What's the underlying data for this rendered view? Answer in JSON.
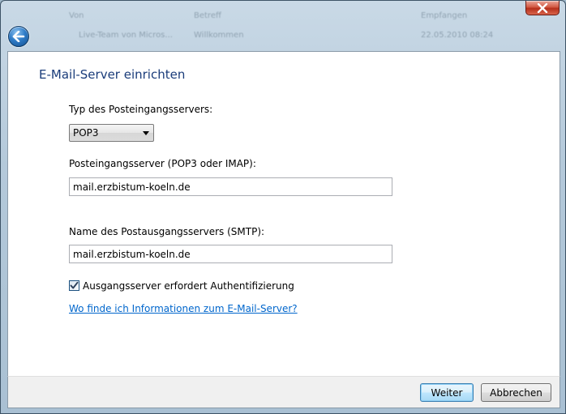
{
  "background_window": {
    "ghost_texts": [
      "Von",
      "Betreff",
      "Empfangen",
      "Live-Team von Micros...",
      "Willkommen",
      "22.05.2010 08:24"
    ]
  },
  "colors": {
    "title_text": "#1a3c7a",
    "link": "#0066cc",
    "close_button": "#c9402a",
    "back_button": "#2f7cc8"
  },
  "icons": {
    "close": "close-x-icon",
    "back": "back-arrow-icon",
    "dropdown": "chevron-down-icon",
    "check": "checkmark-icon"
  },
  "dialog": {
    "title": "E-Mail-Server einrichten",
    "incoming_type": {
      "label": "Typ des Posteingangsservers:",
      "selected": "POP3"
    },
    "incoming_server": {
      "label": "Posteingangsserver (POP3 oder IMAP):",
      "value": "mail.erzbistum-koeln.de"
    },
    "outgoing_server": {
      "label": "Name des Postausgangsservers (SMTP):",
      "value": "mail.erzbistum-koeln.de"
    },
    "auth_checkbox": {
      "label": "Ausgangsserver erfordert Authentifizierung",
      "checked": true
    },
    "help_link": "Wo finde ich Informationen zum E-Mail-Server?"
  },
  "footer": {
    "next_label": "Weiter",
    "cancel_label": "Abbrechen"
  }
}
